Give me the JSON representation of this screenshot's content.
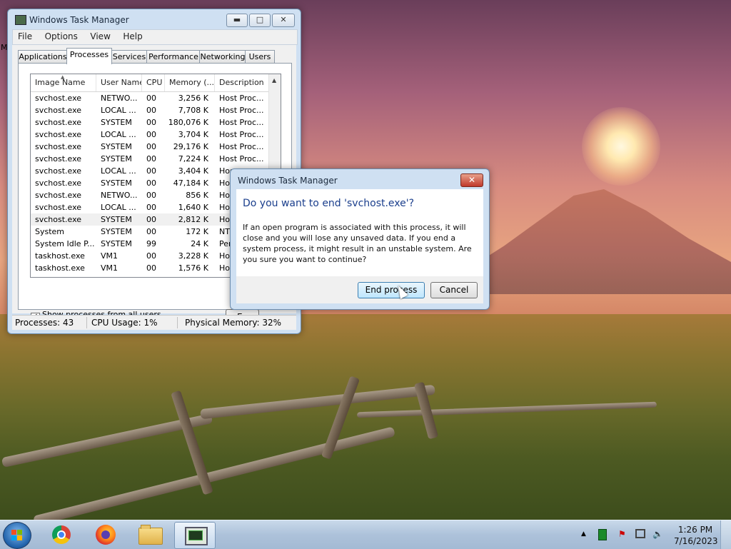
{
  "task_manager": {
    "title": "Windows Task Manager",
    "menu": [
      "File",
      "Options",
      "View",
      "Help"
    ],
    "tabs": [
      "Applications",
      "Processes",
      "Services",
      "Performance",
      "Networking",
      "Users"
    ],
    "active_tab": "Processes",
    "columns": [
      "Image Name",
      "User Name",
      "CPU",
      "Memory (...",
      "Description"
    ],
    "rows": [
      {
        "image": "svchost.exe",
        "user": "NETWO...",
        "cpu": "00",
        "mem": "3,256 K",
        "desc": "Host Proc..."
      },
      {
        "image": "svchost.exe",
        "user": "LOCAL ...",
        "cpu": "00",
        "mem": "7,708 K",
        "desc": "Host Proc..."
      },
      {
        "image": "svchost.exe",
        "user": "SYSTEM",
        "cpu": "00",
        "mem": "180,076 K",
        "desc": "Host Proc..."
      },
      {
        "image": "svchost.exe",
        "user": "LOCAL ...",
        "cpu": "00",
        "mem": "3,704 K",
        "desc": "Host Proc..."
      },
      {
        "image": "svchost.exe",
        "user": "SYSTEM",
        "cpu": "00",
        "mem": "29,176 K",
        "desc": "Host Proc..."
      },
      {
        "image": "svchost.exe",
        "user": "SYSTEM",
        "cpu": "00",
        "mem": "7,224 K",
        "desc": "Host Proc..."
      },
      {
        "image": "svchost.exe",
        "user": "LOCAL ...",
        "cpu": "00",
        "mem": "3,404 K",
        "desc": "Hos"
      },
      {
        "image": "svchost.exe",
        "user": "SYSTEM",
        "cpu": "00",
        "mem": "47,184 K",
        "desc": "Hos"
      },
      {
        "image": "svchost.exe",
        "user": "NETWO...",
        "cpu": "00",
        "mem": "856 K",
        "desc": "Hos"
      },
      {
        "image": "svchost.exe",
        "user": "LOCAL ...",
        "cpu": "00",
        "mem": "1,640 K",
        "desc": "Hos"
      },
      {
        "image": "svchost.exe",
        "user": "SYSTEM",
        "cpu": "00",
        "mem": "2,812 K",
        "desc": "Hos"
      },
      {
        "image": "System",
        "user": "SYSTEM",
        "cpu": "00",
        "mem": "172 K",
        "desc": "NT"
      },
      {
        "image": "System Idle P...",
        "user": "SYSTEM",
        "cpu": "99",
        "mem": "24 K",
        "desc": "Per"
      },
      {
        "image": "taskhost.exe",
        "user": "VM1",
        "cpu": "00",
        "mem": "3,228 K",
        "desc": "Hos"
      },
      {
        "image": "taskhost.exe",
        "user": "VM1",
        "cpu": "00",
        "mem": "1,576 K",
        "desc": "Hos"
      }
    ],
    "selected_row": 10,
    "show_all_users_label": "Show processes from all users",
    "show_all_users_checked": true,
    "end_button_label": "E",
    "status": {
      "processes": "Processes: 43",
      "cpu": "CPU Usage: 1%",
      "memory": "Physical Memory: 32%"
    }
  },
  "dialog": {
    "title": "Windows Task Manager",
    "question": "Do you want to end 'svchost.exe'?",
    "message": "If an open program is associated with this process, it will close and you will lose any unsaved data. If you end a system process, it might result in an unstable system. Are you sure you want to continue?",
    "end_process_label": "End process",
    "cancel_label": "Cancel",
    "close_glyph": "✕"
  },
  "taskbar": {
    "pinned": [
      "chrome-icon",
      "firefox-icon",
      "folder-icon",
      "task-manager-icon"
    ],
    "time": "1:26 PM",
    "date": "7/16/2023"
  },
  "desktop": {
    "stray_letter": "M"
  }
}
